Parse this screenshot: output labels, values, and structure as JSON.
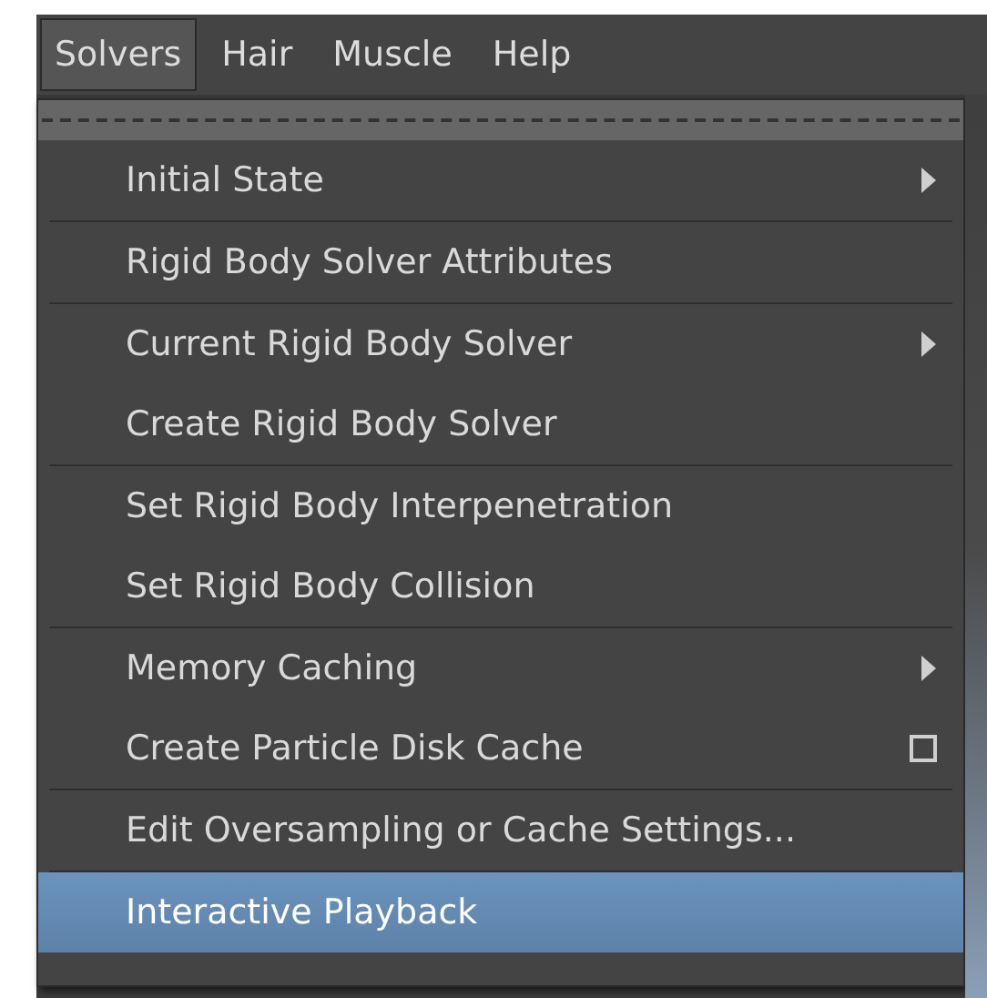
{
  "menu_bar": [
    {
      "label": "Solvers",
      "selected": true
    },
    {
      "label": "Hair",
      "selected": false
    },
    {
      "label": "Muscle",
      "selected": false
    },
    {
      "label": "Help",
      "selected": false
    }
  ],
  "menu": {
    "groups": [
      {
        "items": [
          {
            "label": "Initial State",
            "kind": "submenu",
            "selected": false
          }
        ]
      },
      {
        "items": [
          {
            "label": "Rigid Body Solver Attributes",
            "kind": "plain",
            "selected": false
          }
        ]
      },
      {
        "items": [
          {
            "label": "Current Rigid Body Solver",
            "kind": "submenu",
            "selected": false
          },
          {
            "label": "Create Rigid Body Solver",
            "kind": "plain",
            "selected": false
          }
        ]
      },
      {
        "items": [
          {
            "label": "Set Rigid Body Interpenetration",
            "kind": "plain",
            "selected": false
          },
          {
            "label": "Set Rigid Body Collision",
            "kind": "plain",
            "selected": false
          }
        ]
      },
      {
        "items": [
          {
            "label": "Memory Caching",
            "kind": "submenu",
            "selected": false
          },
          {
            "label": "Create Particle Disk Cache",
            "kind": "option",
            "selected": false
          }
        ]
      },
      {
        "items": [
          {
            "label": "Edit Oversampling or Cache Settings...",
            "kind": "plain",
            "selected": false
          }
        ]
      },
      {
        "items": [
          {
            "label": "Interactive Playback",
            "kind": "plain",
            "selected": true
          }
        ]
      }
    ]
  }
}
